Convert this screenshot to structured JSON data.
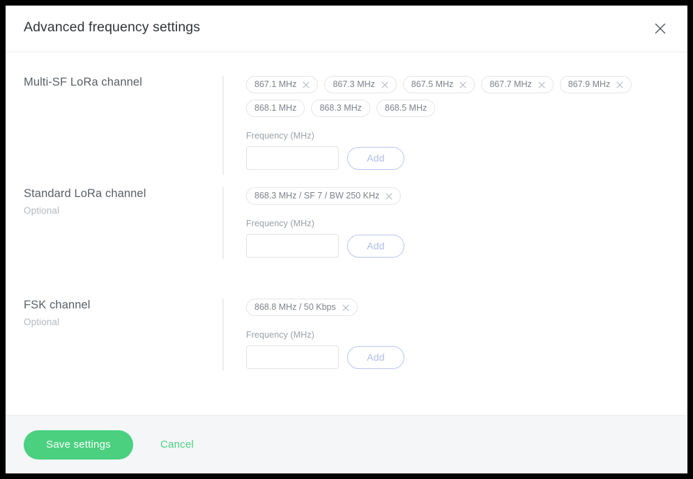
{
  "dialog": {
    "title": "Advanced frequency settings",
    "close_icon": "close-icon"
  },
  "sections": [
    {
      "title": "Multi-SF LoRa channel",
      "subtitle": "",
      "chips": [
        {
          "label": "867.1 MHz",
          "removable": true
        },
        {
          "label": "867.3 MHz",
          "removable": true
        },
        {
          "label": "867.5 MHz",
          "removable": true
        },
        {
          "label": "867.7 MHz",
          "removable": true
        },
        {
          "label": "867.9 MHz",
          "removable": true
        },
        {
          "label": "868.1 MHz",
          "removable": false
        },
        {
          "label": "868.3 MHz",
          "removable": false
        },
        {
          "label": "868.5 MHz",
          "removable": false
        }
      ],
      "field_label": "Frequency (MHz)",
      "field_value": "",
      "field_placeholder": "",
      "add_label": "Add"
    },
    {
      "title": "Standard LoRa channel",
      "subtitle": "Optional",
      "chips": [
        {
          "label": "868.3 MHz / SF 7 / BW 250 KHz",
          "removable": true
        }
      ],
      "field_label": "Frequency (MHz)",
      "field_value": "",
      "field_placeholder": "",
      "add_label": "Add"
    },
    {
      "title": "FSK channel",
      "subtitle": "Optional",
      "chips": [
        {
          "label": "868.8 MHz / 50 Kbps",
          "removable": true
        }
      ],
      "field_label": "Frequency (MHz)",
      "field_value": "",
      "field_placeholder": "",
      "add_label": "Add"
    }
  ],
  "footer": {
    "save_label": "Save settings",
    "cancel_label": "Cancel"
  },
  "colors": {
    "accent_green": "#4ad07f",
    "add_button_border": "#b7c4ef",
    "chip_border": "#e3e5e8",
    "footer_background": "#f5f6f8"
  }
}
